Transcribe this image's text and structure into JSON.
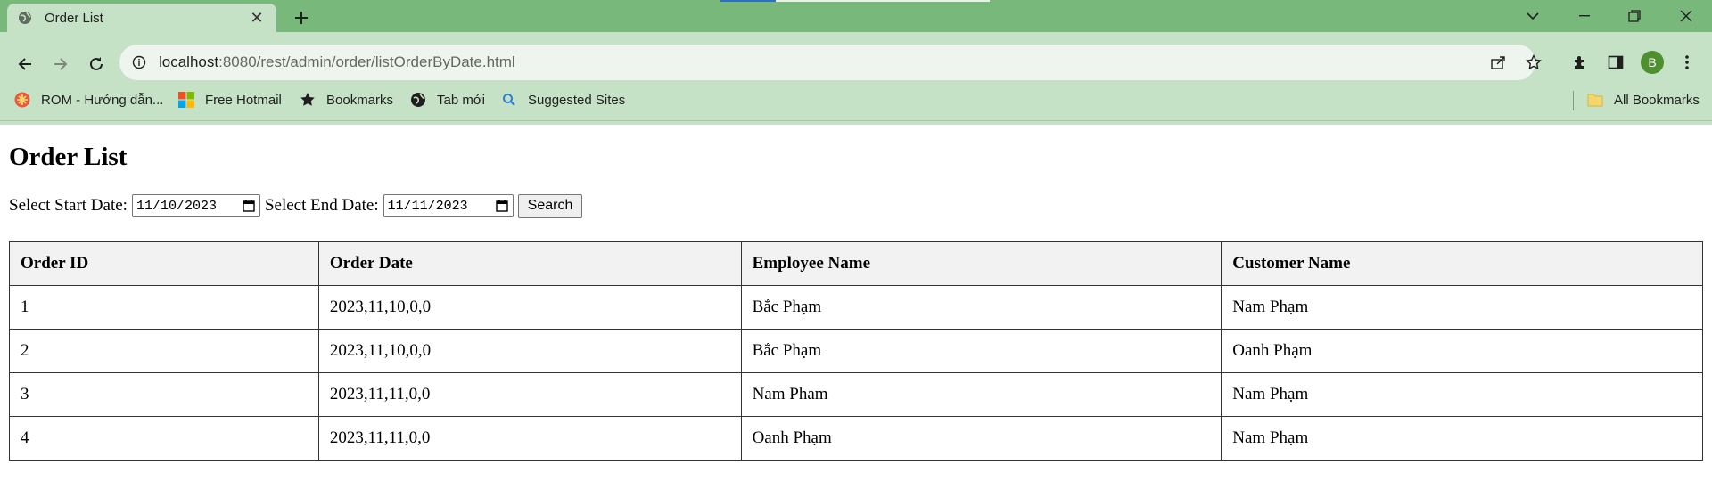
{
  "browser": {
    "tab_title": "Order List",
    "address": {
      "host": "localhost",
      "path": ":8080/rest/admin/order/listOrderByDate.html"
    },
    "bookmarks": [
      {
        "label": "ROM - Hướng dẫn...",
        "icon": "orange-flower-icon"
      },
      {
        "label": "Free Hotmail",
        "icon": "windows-logo-icon"
      },
      {
        "label": "Bookmarks",
        "icon": "star-icon"
      },
      {
        "label": "Tab mới",
        "icon": "globe-icon"
      },
      {
        "label": "Suggested Sites",
        "icon": "search-icon"
      }
    ],
    "all_bookmarks": "All Bookmarks",
    "profile_initial": "B",
    "colors": {
      "tabbar": "#78b87a",
      "toolbar": "#c5e2c6",
      "avatar": "#4e8f2f"
    }
  },
  "page": {
    "title": "Order List",
    "start_label": "Select Start Date:",
    "start_value": "11/10/2023",
    "end_label": "Select End Date:",
    "end_value": "11/11/2023",
    "search_label": "Search",
    "table": {
      "headers": [
        "Order ID",
        "Order Date",
        "Employee Name",
        "Customer Name"
      ],
      "rows": [
        [
          "1",
          "2023,11,10,0,0",
          "Bắc Phạm",
          "Nam Phạm"
        ],
        [
          "2",
          "2023,11,10,0,0",
          "Bắc Phạm",
          "Oanh Phạm"
        ],
        [
          "3",
          "2023,11,11,0,0",
          "Nam Pham",
          "Nam Phạm"
        ],
        [
          "4",
          "2023,11,11,0,0",
          "Oanh Phạm",
          "Nam Phạm"
        ]
      ]
    }
  }
}
